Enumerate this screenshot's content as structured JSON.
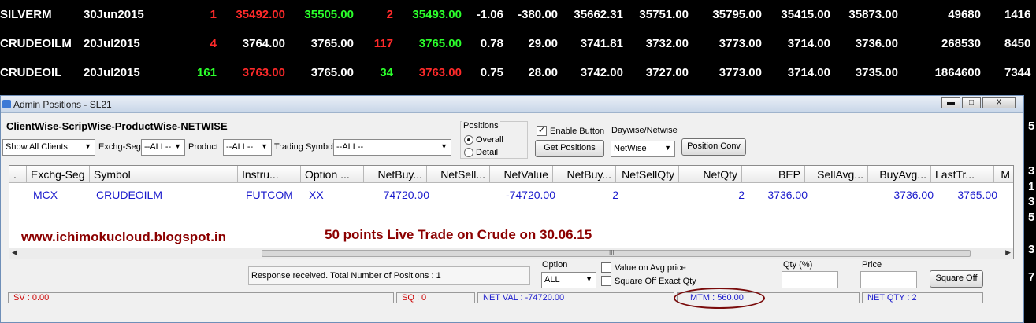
{
  "market_watch": [
    {
      "symbol": "SILVERM",
      "expiry": "30Jun2015",
      "buy_qty": "1",
      "buy_price": "35492.00",
      "sell_price": "35505.00",
      "sell_qty": "2",
      "ltp": "35493.00",
      "pct_change": "-1.06",
      "net_change": "-380.00",
      "atp": "35662.31",
      "open": "35751.00",
      "high": "35795.00",
      "low": "35415.00",
      "close": "35873.00",
      "volume": "49680",
      "extra": "1416"
    },
    {
      "symbol": "CRUDEOILM",
      "expiry": "20Jul2015",
      "buy_qty": "4",
      "buy_price": "3764.00",
      "sell_price": "3765.00",
      "sell_qty": "117",
      "ltp": "3765.00",
      "pct_change": "0.78",
      "net_change": "29.00",
      "atp": "3741.81",
      "open": "3732.00",
      "high": "3773.00",
      "low": "3714.00",
      "close": "3736.00",
      "volume": "268530",
      "extra": "8450"
    },
    {
      "symbol": "CRUDEOIL",
      "expiry": "20Jul2015",
      "buy_qty": "161",
      "buy_price": "3763.00",
      "sell_price": "3765.00",
      "sell_qty": "34",
      "ltp": "3763.00",
      "pct_change": "0.75",
      "net_change": "28.00",
      "atp": "3742.00",
      "open": "3727.00",
      "high": "3773.00",
      "low": "3714.00",
      "close": "3735.00",
      "volume": "1864600",
      "extra": "7344"
    }
  ],
  "right_edge_digits": [
    "5",
    "3",
    "1",
    "3",
    "5",
    "3",
    "7"
  ],
  "window": {
    "title": "Admin Positions - SL21",
    "min_label": "▬",
    "max_label": "□",
    "close_label": "X"
  },
  "toolbar": {
    "heading": "ClientWise-ScripWise-ProductWise-NETWISE",
    "client_select": "Show All Clients",
    "exchg_label": "Exchg-Seg",
    "exchg_select": "--ALL--",
    "product_label": "Product",
    "product_select": "--ALL--",
    "trading_symbol_label": "Trading Symbol",
    "trading_symbol_select": "--ALL--",
    "positions_label": "Positions",
    "overall_label": "Overall",
    "detail_label": "Detail",
    "enable_button_label": "Enable Button",
    "get_positions_label": "Get Positions",
    "daywise_label": "Daywise/Netwise",
    "netwise_select": "NetWise",
    "position_conv_label": "Position Conv"
  },
  "grid": {
    "columns": [
      ".",
      "Exchg-Seg",
      "Symbol",
      "Instru...",
      "Option ...",
      "NetBuy...",
      "NetSell...",
      "NetValue",
      "NetBuy...",
      "NetSellQty",
      "NetQty",
      "BEP",
      "SellAvg...",
      "BuyAvg...",
      "LastTr...",
      "M"
    ],
    "rows": [
      {
        "exchg_seg": "MCX",
        "symbol": "CRUDEOILM",
        "instrument": "FUTCOM",
        "option": "XX",
        "net_buy_value": "74720.00",
        "net_sell_value": "",
        "net_value": "-74720.00",
        "net_buy_qty": "2",
        "net_sell_qty": "",
        "net_qty": "2",
        "bep": "3736.00",
        "sell_avg": "",
        "buy_avg": "3736.00",
        "last_traded": "3765.00"
      }
    ],
    "scroll_label": "III"
  },
  "watermark": {
    "url": "www.ichimokucloud.blogspot.in",
    "caption": "50 points Live Trade on Crude on 30.06.15"
  },
  "bottom_panel": {
    "response_message": "Response received. Total Number of Positions : 1",
    "option_label": "Option",
    "option_select": "ALL",
    "value_on_avg_label": "Value on Avg  price",
    "square_off_exact_label": "Square Off Exact Qty",
    "qty_pct_label": "Qty (%)",
    "price_label": "Price",
    "square_off_button": "Square Off"
  },
  "status": {
    "sv": "SV : 0.00",
    "sq": "SQ : 0",
    "net_val": "NET VAL : -74720.00",
    "mtm": "MTM : 560.00",
    "net_qty": "NET QTY : 2"
  },
  "colors": {
    "bid_ask_red": "#ff2a2a",
    "bid_ask_green": "#2bff2b",
    "grid_text_blue": "#1a1acc",
    "watermark_darkred": "#8b0000",
    "status_red": "#cc0000",
    "status_blue": "#1a1acc",
    "highlight_ellipse": "#7a0c0c"
  }
}
